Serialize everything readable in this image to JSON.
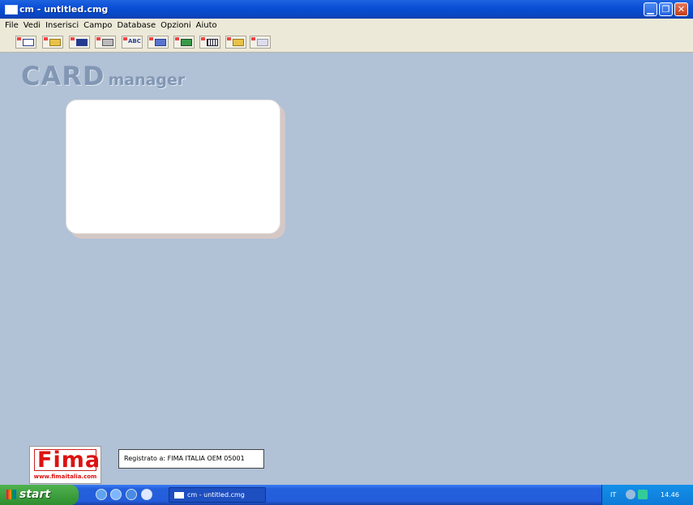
{
  "window": {
    "title": "cm -  untitled.cmg"
  },
  "menu": [
    "File",
    "Vedi",
    "Inserisci",
    "Campo",
    "Database",
    "Opzioni",
    "Aiuto"
  ],
  "toolbar": {
    "buttons": [
      {
        "icon": "new-card-icon"
      },
      {
        "icon": "open-folder-icon"
      },
      {
        "icon": "save-icon"
      },
      {
        "icon": "print-icon"
      },
      {
        "icon": "text-field-icon",
        "label": "ABC"
      },
      {
        "icon": "rectangle-field-icon"
      },
      {
        "icon": "image-field-icon"
      },
      {
        "icon": "barcode-field-icon"
      },
      {
        "icon": "open-database-icon"
      },
      {
        "icon": "database-view-icon"
      }
    ]
  },
  "workspace": {
    "logo_main": "CARD",
    "logo_sub": "manager",
    "background": "#b1c1d6"
  },
  "brand": {
    "name": "Fima",
    "url": "www.fimaitalia.com"
  },
  "registration": "Registrato a: FIMA ITALIA OEM 05001",
  "taskbar": {
    "start_label": "start",
    "task_item": "cm - untitled.cmg",
    "language": "IT",
    "clock": "14.46"
  }
}
